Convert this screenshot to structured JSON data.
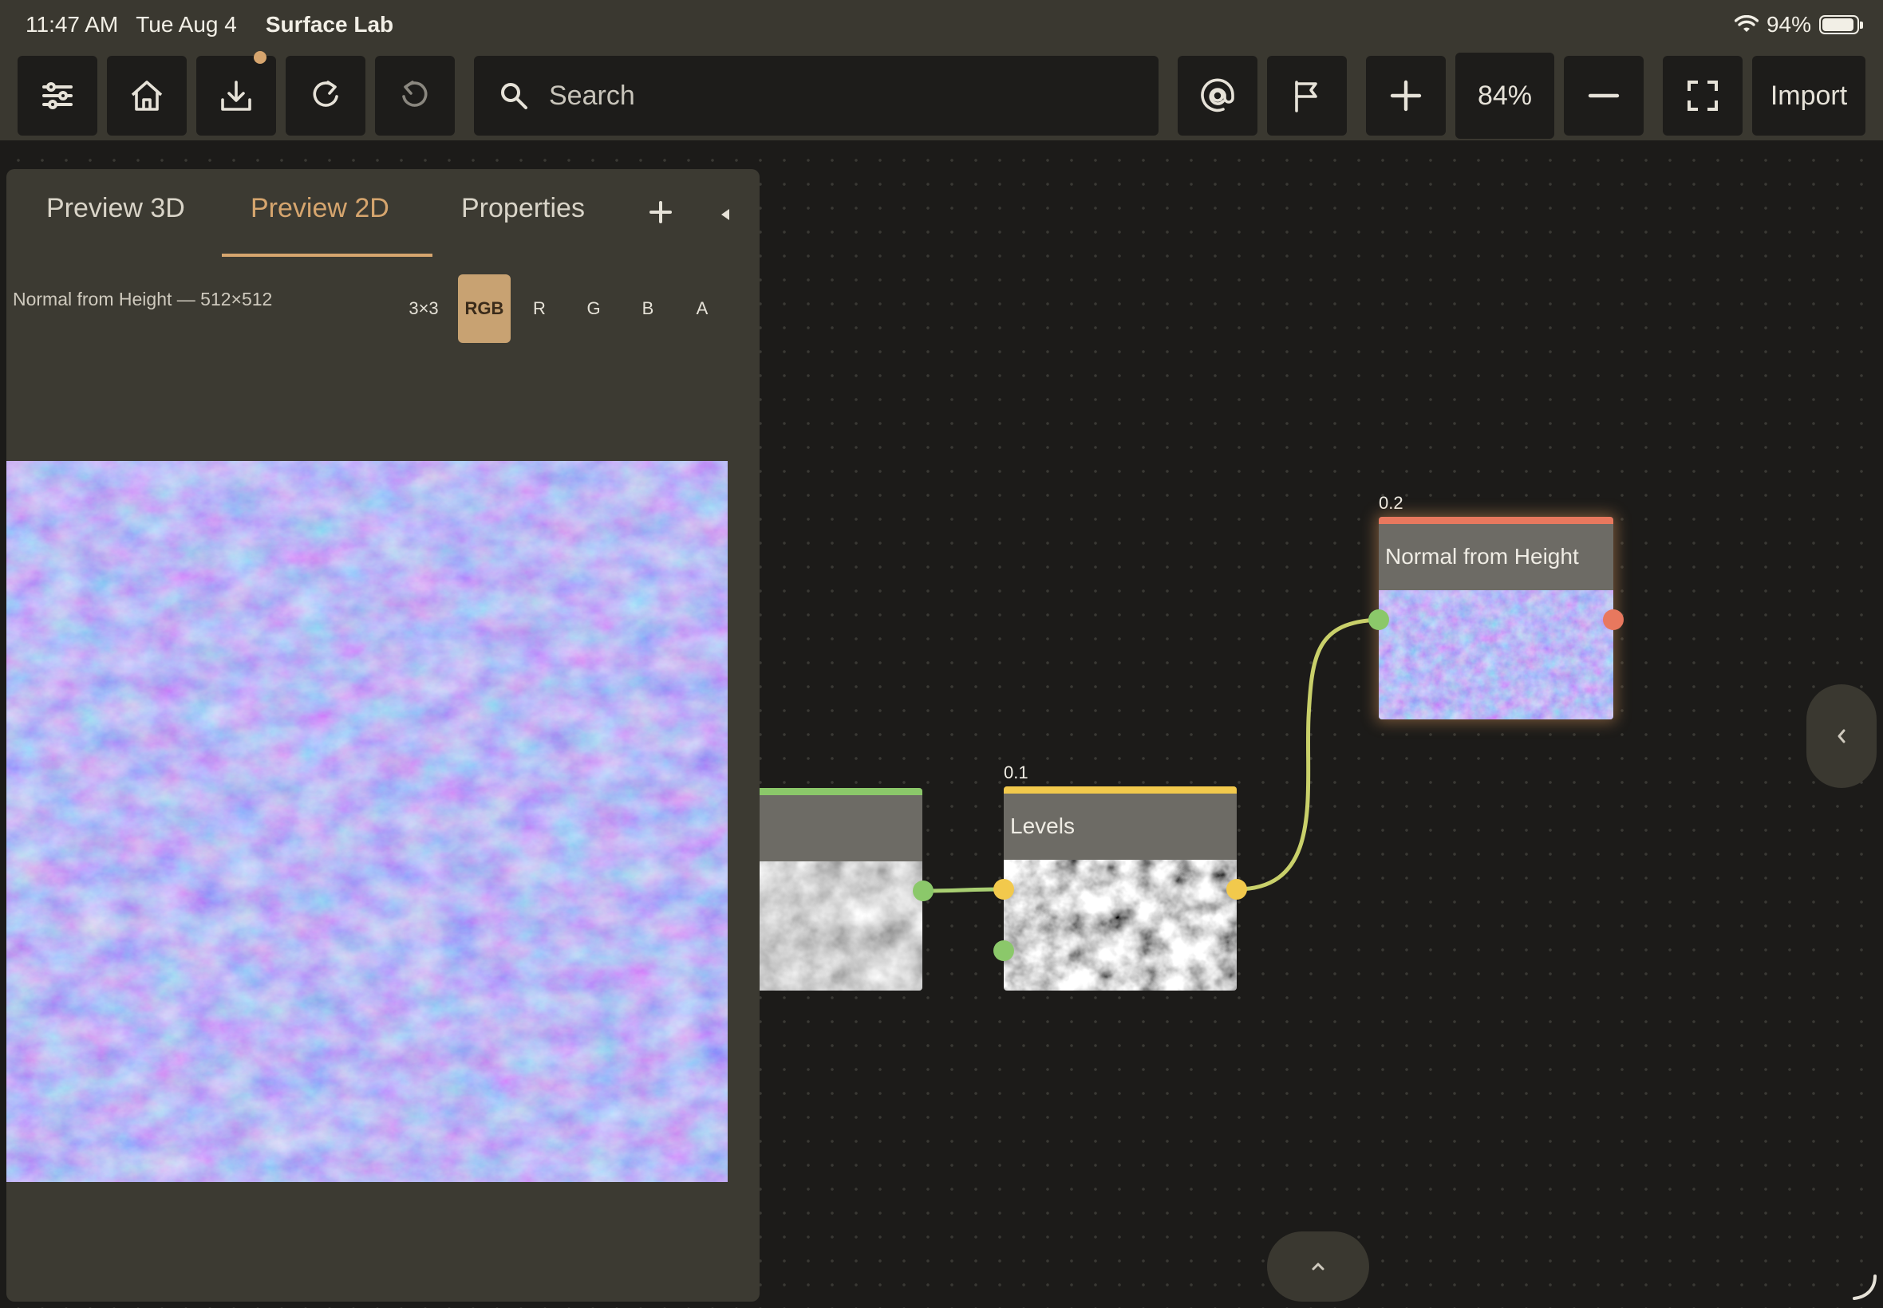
{
  "status_bar": {
    "time": "11:47 AM",
    "date": "Tue Aug 4",
    "app_name": "Surface Lab",
    "wifi_icon": "wifi-icon",
    "battery_percent": "94%",
    "battery_level": 0.94
  },
  "toolbar": {
    "buttons": [
      {
        "name": "settings-sliders-button",
        "icon": "sliders-icon"
      },
      {
        "name": "home-button",
        "icon": "home-icon"
      },
      {
        "name": "download-button",
        "icon": "download-icon",
        "badge": true
      },
      {
        "name": "redo-button",
        "icon": "redo-icon"
      },
      {
        "name": "undo-button",
        "icon": "undo-icon",
        "disabled": true
      },
      {
        "name": "link-button",
        "icon": "at-link-icon"
      },
      {
        "name": "flag-button",
        "icon": "flag-icon"
      },
      {
        "name": "zoom-in-button",
        "icon": "plus-icon"
      },
      {
        "name": "zoom-out-button",
        "icon": "minus-icon"
      },
      {
        "name": "fit-view-button",
        "icon": "frame-icon"
      }
    ],
    "search_placeholder": "Search",
    "zoom_level": "84%",
    "import_label": "Import"
  },
  "panel": {
    "tabs": [
      {
        "label": "Preview 3D",
        "active": false
      },
      {
        "label": "Preview 2D",
        "active": true
      },
      {
        "label": "Properties",
        "active": false
      }
    ],
    "preview_info": "Normal from Height — 512×512",
    "tile_mode": "3×3",
    "channels": [
      "RGB",
      "R",
      "G",
      "B",
      "A"
    ],
    "active_channel": "RGB"
  },
  "nodes": [
    {
      "name": "source-node",
      "title": "",
      "time": "",
      "accent": "#8bc86a"
    },
    {
      "name": "levels-node",
      "title": "Levels",
      "time": "0.1 ms",
      "accent": "#f2c94c"
    },
    {
      "name": "normal-from-height-node",
      "title": "Normal from Height",
      "time": "0.2 ms",
      "accent": "#e8785e"
    }
  ],
  "colors": {
    "accent": "#d6a56e",
    "port_green": "#8bc86a",
    "port_yellow": "#f2c94c",
    "port_orange": "#e8785e",
    "edge_green": "#a9cf72",
    "edge_yellow": "#e9c95a"
  }
}
